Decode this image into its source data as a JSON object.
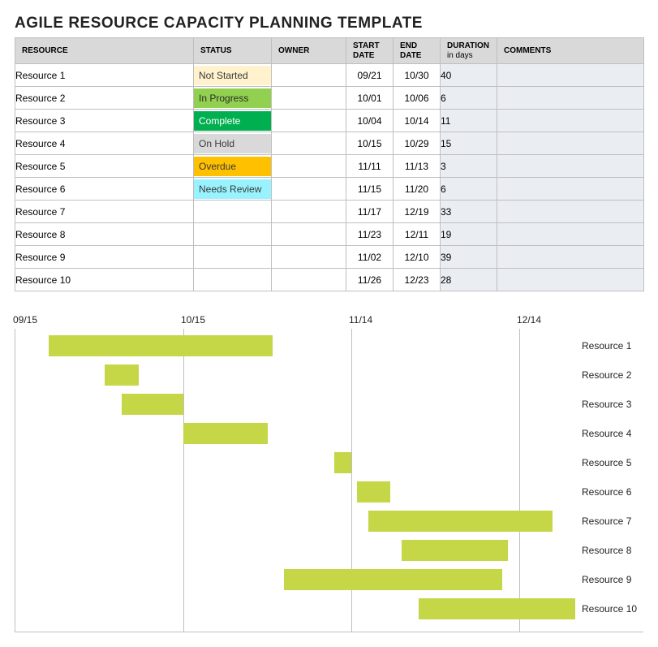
{
  "title": "AGILE RESOURCE CAPACITY PLANNING TEMPLATE",
  "columns": {
    "resource": "RESOURCE",
    "status": "STATUS",
    "owner": "OWNER",
    "start": "START DATE",
    "end": "END DATE",
    "duration": "DURATION",
    "duration_sub": "in days",
    "comments": "COMMENTS"
  },
  "status_classes": {
    "Not Started": "st-notstarted",
    "In Progress": "st-inprogress",
    "Complete": "st-complete",
    "On Hold": "st-onhold",
    "Overdue": "st-overdue",
    "Needs Review": "st-review"
  },
  "rows": [
    {
      "resource": "Resource 1",
      "status": "Not Started",
      "owner": "",
      "start": "09/21",
      "end": "10/30",
      "duration": "40",
      "comments": ""
    },
    {
      "resource": "Resource 2",
      "status": "In Progress",
      "owner": "",
      "start": "10/01",
      "end": "10/06",
      "duration": "6",
      "comments": ""
    },
    {
      "resource": "Resource 3",
      "status": "Complete",
      "owner": "",
      "start": "10/04",
      "end": "10/14",
      "duration": "11",
      "comments": ""
    },
    {
      "resource": "Resource 4",
      "status": "On Hold",
      "owner": "",
      "start": "10/15",
      "end": "10/29",
      "duration": "15",
      "comments": ""
    },
    {
      "resource": "Resource 5",
      "status": "Overdue",
      "owner": "",
      "start": "11/11",
      "end": "11/13",
      "duration": "3",
      "comments": ""
    },
    {
      "resource": "Resource 6",
      "status": "Needs Review",
      "owner": "",
      "start": "11/15",
      "end": "11/20",
      "duration": "6",
      "comments": ""
    },
    {
      "resource": "Resource 7",
      "status": "",
      "owner": "",
      "start": "11/17",
      "end": "12/19",
      "duration": "33",
      "comments": ""
    },
    {
      "resource": "Resource 8",
      "status": "",
      "owner": "",
      "start": "11/23",
      "end": "12/11",
      "duration": "19",
      "comments": ""
    },
    {
      "resource": "Resource 9",
      "status": "",
      "owner": "",
      "start": "11/02",
      "end": "12/10",
      "duration": "39",
      "comments": ""
    },
    {
      "resource": "Resource 10",
      "status": "",
      "owner": "",
      "start": "11/26",
      "end": "12/23",
      "duration": "28",
      "comments": ""
    }
  ],
  "chart_data": {
    "type": "bar",
    "orientation": "gantt",
    "x_axis": {
      "origin": "09/15",
      "ticks": [
        "09/15",
        "10/15",
        "11/14",
        "12/14"
      ],
      "tick_days_from_origin": [
        0,
        30,
        60,
        90
      ],
      "days_span": 100
    },
    "bar_color": "#c5d647",
    "series": [
      {
        "name": "Resource 1",
        "start": "09/21",
        "end": "10/30",
        "start_offset_days": 6,
        "duration_days": 40
      },
      {
        "name": "Resource 2",
        "start": "10/01",
        "end": "10/06",
        "start_offset_days": 16,
        "duration_days": 6
      },
      {
        "name": "Resource 3",
        "start": "10/04",
        "end": "10/14",
        "start_offset_days": 19,
        "duration_days": 11
      },
      {
        "name": "Resource 4",
        "start": "10/15",
        "end": "10/29",
        "start_offset_days": 30,
        "duration_days": 15
      },
      {
        "name": "Resource 5",
        "start": "11/11",
        "end": "11/13",
        "start_offset_days": 57,
        "duration_days": 3
      },
      {
        "name": "Resource 6",
        "start": "11/15",
        "end": "11/20",
        "start_offset_days": 61,
        "duration_days": 6
      },
      {
        "name": "Resource 7",
        "start": "11/17",
        "end": "12/19",
        "start_offset_days": 63,
        "duration_days": 33
      },
      {
        "name": "Resource 8",
        "start": "11/23",
        "end": "12/11",
        "start_offset_days": 69,
        "duration_days": 19
      },
      {
        "name": "Resource 9",
        "start": "11/02",
        "end": "12/10",
        "start_offset_days": 48,
        "duration_days": 39
      },
      {
        "name": "Resource 10",
        "start": "11/26",
        "end": "12/23",
        "start_offset_days": 72,
        "duration_days": 28
      }
    ]
  }
}
